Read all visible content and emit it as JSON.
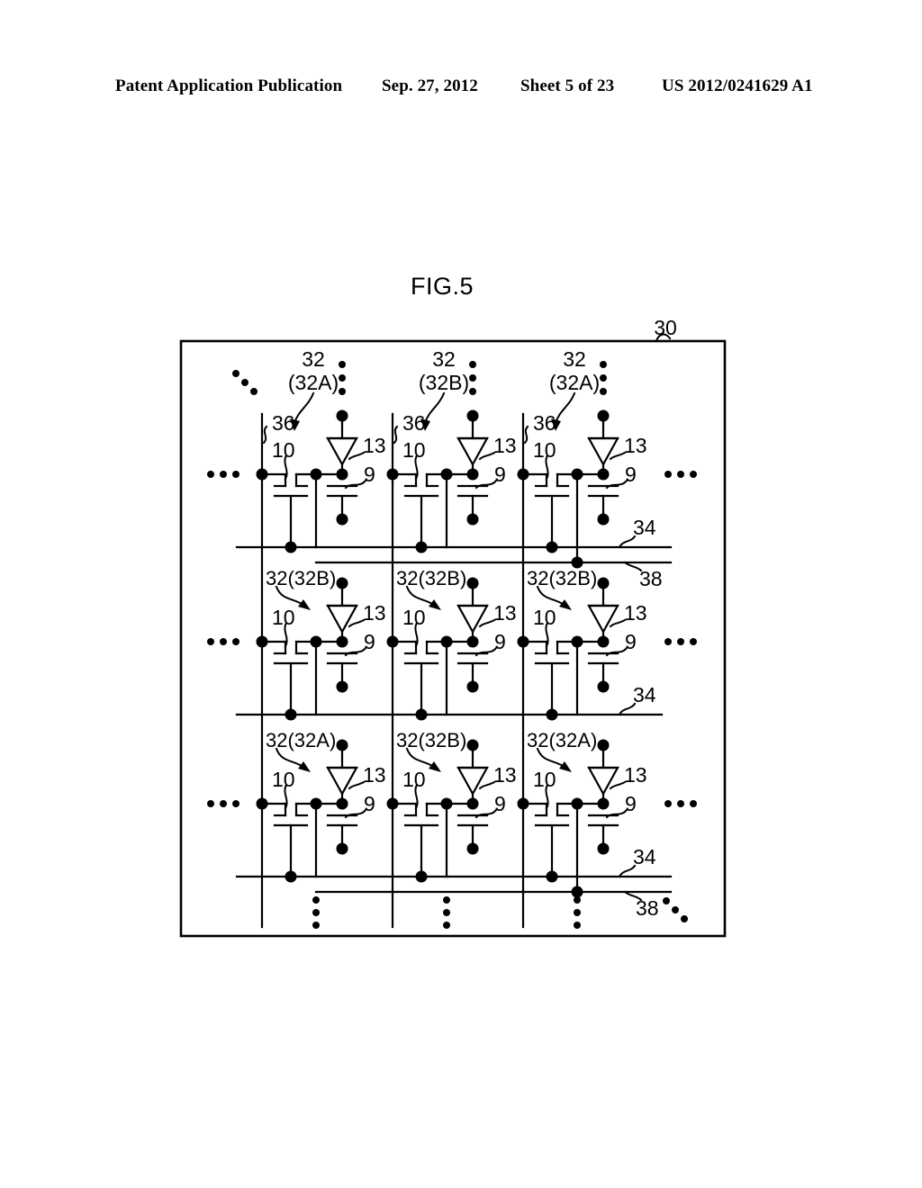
{
  "page": {
    "header": {
      "publication": "Patent Application Publication",
      "date": "Sep. 27, 2012",
      "sheet": "Sheet 5 of 23",
      "doc_number": "US 2012/0241629 A1"
    },
    "figure_title": "FIG.5"
  },
  "figure": {
    "panel_ref": "30",
    "row_line_ref": "34",
    "common_line_ref": "38",
    "common_line_ref_bottom": "38",
    "column_line_ref": "36",
    "transistor_ref": "10",
    "diode_ref": "13",
    "capacitor_ref": "9",
    "pixel_ref": "32",
    "rows": [
      {
        "row_index": 1,
        "label_style": "two-line",
        "cells": [
          {
            "ref_top": "32",
            "ref_bottom": "(32A)",
            "column_ref": "36",
            "transistor": "10",
            "diode": "13",
            "capacitor": "9"
          },
          {
            "ref_top": "32",
            "ref_bottom": "(32B)",
            "column_ref": "36",
            "transistor": "10",
            "diode": "13",
            "capacitor": "9"
          },
          {
            "ref_top": "32",
            "ref_bottom": "(32A)",
            "column_ref": "36",
            "transistor": "10",
            "diode": "13",
            "capacitor": "9"
          }
        ],
        "row_line_ref": "34",
        "common_line_ref": "38"
      },
      {
        "row_index": 2,
        "label_style": "one-line",
        "cells": [
          {
            "ref_top": "32(32B)",
            "ref_bottom": "",
            "column_ref": "",
            "transistor": "10",
            "diode": "13",
            "capacitor": "9"
          },
          {
            "ref_top": "32(32B)",
            "ref_bottom": "",
            "column_ref": "",
            "transistor": "10",
            "diode": "13",
            "capacitor": "9"
          },
          {
            "ref_top": "32(32B)",
            "ref_bottom": "",
            "column_ref": "",
            "transistor": "10",
            "diode": "13",
            "capacitor": "9"
          }
        ],
        "row_line_ref": "34",
        "common_line_ref": ""
      },
      {
        "row_index": 3,
        "label_style": "one-line",
        "cells": [
          {
            "ref_top": "32(32A)",
            "ref_bottom": "",
            "column_ref": "",
            "transistor": "10",
            "diode": "13",
            "capacitor": "9"
          },
          {
            "ref_top": "32(32B)",
            "ref_bottom": "",
            "column_ref": "",
            "transistor": "10",
            "diode": "13",
            "capacitor": "9"
          },
          {
            "ref_top": "32(32A)",
            "ref_bottom": "",
            "column_ref": "",
            "transistor": "10",
            "diode": "13",
            "capacitor": "9"
          }
        ],
        "row_line_ref": "34",
        "common_line_ref": "38"
      }
    ],
    "ellipsis": {
      "left_rows": [
        "...",
        "...",
        "..."
      ],
      "right_rows": [
        "...",
        "...",
        "..."
      ],
      "top_columns": [
        "⋮",
        "⋮",
        "⋮"
      ],
      "bottom_columns": [
        "⋮",
        "⋮",
        "⋮"
      ],
      "corner_top_left": "⋱",
      "corner_bottom_right": "⋱"
    },
    "colors": {
      "ink": "#000000",
      "paper": "#ffffff"
    }
  }
}
